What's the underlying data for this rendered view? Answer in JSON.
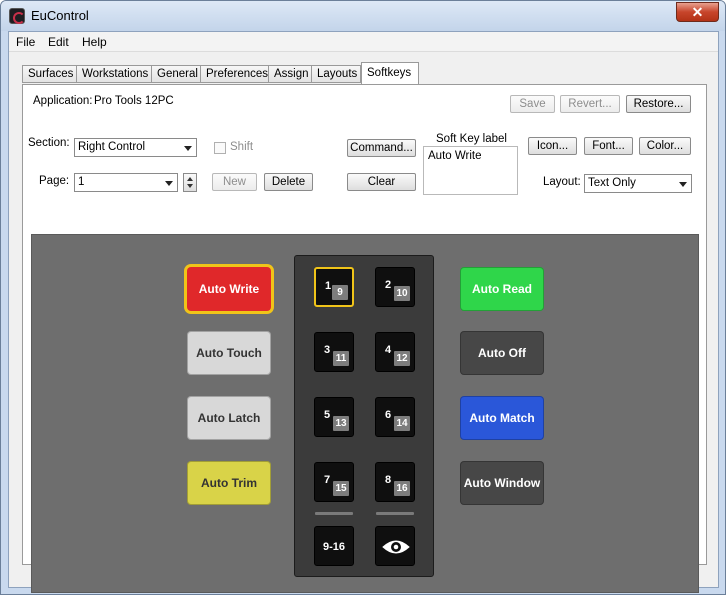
{
  "window": {
    "title": "EuControl",
    "close_glyph": "✕"
  },
  "menu": {
    "items": [
      "File",
      "Edit",
      "Help"
    ]
  },
  "tabs": [
    "Surfaces",
    "Workstations",
    "General",
    "Preferences",
    "Assign",
    "Layouts",
    "Softkeys"
  ],
  "active_tab": "Softkeys",
  "panel": {
    "application_label": "Application:",
    "application_value": "Pro Tools 12PC",
    "save": "Save",
    "revert": "Revert...",
    "restore": "Restore...",
    "section_label": "Section:",
    "section_value": "Right Control",
    "shift_label": "Shift",
    "command": "Command...",
    "soft_key_label_caption": "Soft Key label",
    "soft_key_label_value": "Auto Write",
    "icon": "Icon...",
    "font": "Font...",
    "color": "Color...",
    "page_label": "Page:",
    "page_value": "1",
    "new": "New",
    "delete": "Delete",
    "clear": "Clear",
    "layout_label": "Layout:",
    "layout_value": "Text Only"
  },
  "colors": {
    "auto_write": "#e0282a",
    "auto_touch": "#d8d8d8",
    "auto_latch": "#d8d8d8",
    "auto_trim": "#d9d348",
    "auto_read": "#2fd64a",
    "auto_off": "#474747",
    "auto_match": "#2a57d9",
    "auto_window": "#474747",
    "selection": "#f0c419"
  },
  "softkeys_left": [
    "Auto Write",
    "Auto Touch",
    "Auto Latch",
    "Auto Trim"
  ],
  "softkeys_right": [
    "Auto Read",
    "Auto Off",
    "Auto Match",
    "Auto Window"
  ],
  "keypad": {
    "keys": [
      {
        "main": "1",
        "sub": "9"
      },
      {
        "main": "2",
        "sub": "10"
      },
      {
        "main": "3",
        "sub": "11"
      },
      {
        "main": "4",
        "sub": "12"
      },
      {
        "main": "5",
        "sub": "13"
      },
      {
        "main": "6",
        "sub": "14"
      },
      {
        "main": "7",
        "sub": "15"
      },
      {
        "main": "8",
        "sub": "16"
      }
    ],
    "page_key": "9-16",
    "view_icon": "eye-icon"
  }
}
